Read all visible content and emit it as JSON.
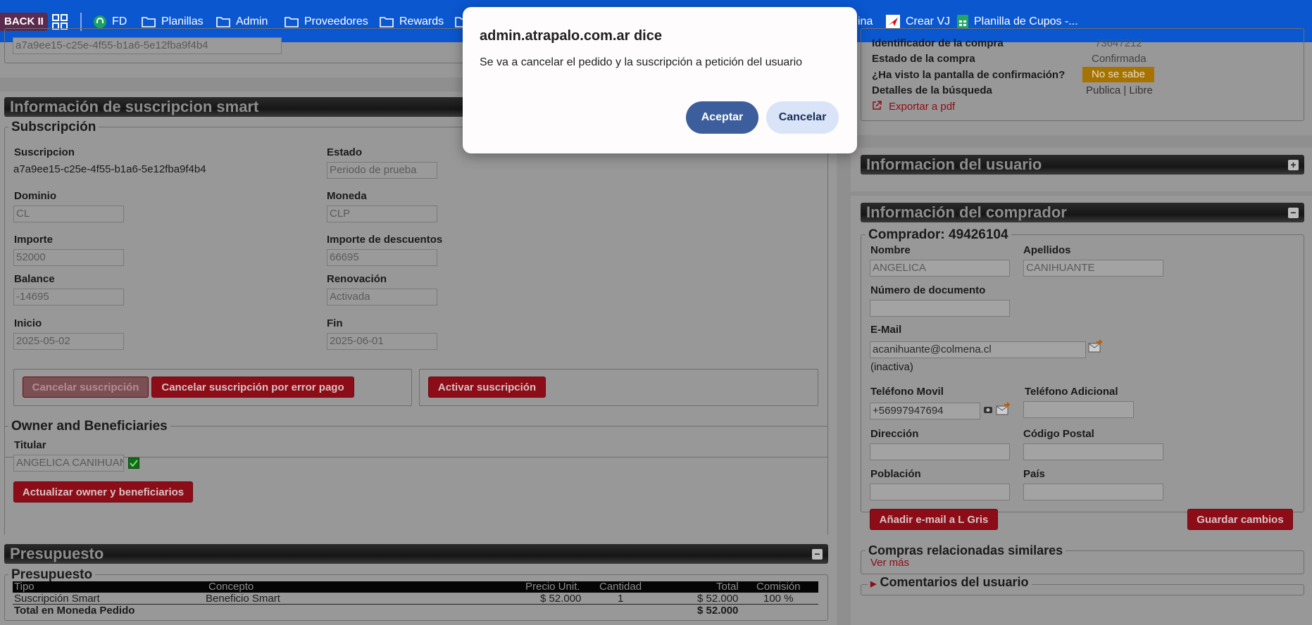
{
  "bookmarks": {
    "back_label": "BACK II",
    "items": [
      {
        "label": "FD"
      },
      {
        "label": "Planillas"
      },
      {
        "label": "Admin"
      },
      {
        "label": "Proveedores"
      },
      {
        "label": "Rewards"
      },
      {
        "label": "ina"
      },
      {
        "label": "Crear VJ"
      },
      {
        "label": "Planilla de Cupos -..."
      }
    ]
  },
  "top_left": {
    "id_value": "a7a9ee15-c25e-4f55-b1a6-5e12fba9f4b4"
  },
  "compra": {
    "rows": [
      {
        "label": "Identificador de la compra",
        "value": "73647212"
      },
      {
        "label": "Estado de la compra",
        "value": "Confirmada"
      },
      {
        "label": "¿Ha visto la pantalla de confirmación?",
        "value": "No se sabe"
      },
      {
        "label": "Detalles de la búsqueda",
        "value": "Publica | Libre"
      }
    ],
    "export_link": "Exportar a pdf"
  },
  "suscripcion": {
    "section_title": "Información de suscripcion smart",
    "fieldset_title": "Subscripción",
    "suscripcion_label": "Suscripcion",
    "suscripcion_value": "a7a9ee15-c25e-4f55-b1a6-5e12fba9f4b4",
    "estado_label": "Estado",
    "estado_value": "Periodo de prueba",
    "dominio_label": "Dominio",
    "dominio_value": "CL",
    "moneda_label": "Moneda",
    "moneda_value": "CLP",
    "importe_label": "Importe",
    "importe_value": "52000",
    "importe_desc_label": "Importe de descuentos",
    "importe_desc_value": "66695",
    "balance_label": "Balance",
    "balance_value": "-14695",
    "renovacion_label": "Renovación",
    "renovacion_value": "Activada",
    "inicio_label": "Inicio",
    "inicio_value": "2025-05-02",
    "fin_label": "Fin",
    "fin_value": "2025-06-01",
    "btn_cancelar": "Cancelar suscripción",
    "btn_cancelar_error": "Cancelar suscripción por error pago",
    "btn_activar": "Activar suscripción"
  },
  "owner": {
    "fieldset_title": "Owner and Beneficiaries",
    "titular_label": "Titular",
    "titular_value": "ANGELICA CANIHUANTE",
    "btn_actualizar": "Actualizar owner y beneficiarios"
  },
  "presupuesto": {
    "section_title": "Presupuesto",
    "fieldset_title": "Presupuesto",
    "headers": {
      "tipo": "Tipo",
      "concepto": "Concepto",
      "precio": "Precio Unit.",
      "cantidad": "Cantidad",
      "total": "Total",
      "comision": "Comisión"
    },
    "row": {
      "tipo": "Suscripción Smart",
      "concepto": "Beneficio Smart",
      "precio": "$ 52.000",
      "cantidad": "1",
      "total": "$ 52.000",
      "comision": "100 %"
    },
    "total_label": "Total en Moneda Pedido",
    "total_value": "$ 52.000"
  },
  "usuario": {
    "section_title": "Informacion del usuario",
    "toggle": "+"
  },
  "comprador": {
    "section_title": "Información del comprador",
    "toggle": "−",
    "fieldset_title": "Comprador: 49426104",
    "nombre_label": "Nombre",
    "nombre_value": "ANGELICA",
    "apellidos_label": "Apellidos",
    "apellidos_value": "CANIHUANTE",
    "documento_label": "Número de documento",
    "documento_value": "",
    "email_label": "E-Mail",
    "email_value": "acanihuante@colmena.cl",
    "email_status": "(inactiva)",
    "movil_label": "Teléfono Movil",
    "movil_value": "+56997947694",
    "adicional_label": "Teléfono Adicional",
    "adicional_value": "",
    "direccion_label": "Dirección",
    "direccion_value": "",
    "cp_label": "Código Postal",
    "cp_value": "",
    "poblacion_label": "Población",
    "poblacion_value": "",
    "pais_label": "País",
    "pais_value": "",
    "btn_gris": "Añadir e-mail a L Gris",
    "btn_guardar": "Guardar cambios",
    "relacionadas_title": "Compras relacionadas similares",
    "ver_mas": "Ver más",
    "comentarios_title": "Comentarios del usuario"
  },
  "presupuesto_toggle": "−",
  "dialog": {
    "title": "admin.atrapalo.com.ar dice",
    "message": "Se va a cancelar el pedido y la suscripción a petición del usuario",
    "ok": "Aceptar",
    "cancel": "Cancelar"
  }
}
